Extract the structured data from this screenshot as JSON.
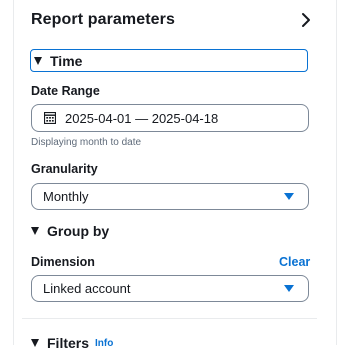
{
  "panel": {
    "title": "Report parameters"
  },
  "time": {
    "section_label": "Time",
    "date_range_label": "Date Range",
    "date_range_value": "2025-04-01 — 2025-04-18",
    "date_hint": "Displaying month to date",
    "granularity_label": "Granularity",
    "granularity_value": "Monthly"
  },
  "group_by": {
    "section_label": "Group by",
    "dimension_label": "Dimension",
    "clear_label": "Clear",
    "dimension_value": "Linked account"
  },
  "filters": {
    "section_label": "Filters",
    "info_label": "Info"
  },
  "colors": {
    "accent": "#0972d3",
    "text": "#16191f",
    "muted": "#5f6b7a",
    "border": "#7d8998"
  },
  "icons": {
    "collapse": "chevron-right-icon",
    "expanded": "triangle-down-icon",
    "calendar": "calendar-icon",
    "dropdown": "caret-down-icon"
  }
}
